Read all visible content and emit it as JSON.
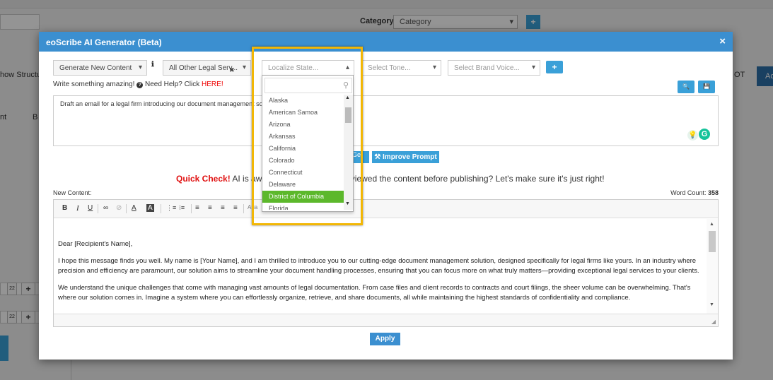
{
  "background": {
    "category_label": "Category",
    "category_select_value": "Category",
    "left_text_1": "how Structu",
    "left_text_2": "nt",
    "left_text_3": "B",
    "right_text_1": "OT",
    "right_text_2": "Ac",
    "row_ctl_1": "22",
    "row_ctl_2": "+"
  },
  "modal": {
    "title": "eoScribe AI Generator (Beta)",
    "close_glyph": "×"
  },
  "controls": {
    "content_type": "Generate New Content",
    "legal_service": "All Other Legal Serv...",
    "state_placeholder": "Localize State...",
    "tone_placeholder": "Select Tone...",
    "brand_voice_placeholder": "Select Brand Voice...",
    "caret": "▾",
    "caret_up": "▴",
    "x_glyph": "✖",
    "info_glyph": "ℹ",
    "plus_glyph": "+"
  },
  "help": {
    "text": "Write something amazing!",
    "need_help": "Need Help? Click",
    "here": "HERE!",
    "q_glyph": "?"
  },
  "icons": {
    "search_glyph": "🔍",
    "save_glyph": "💾",
    "bulb_glyph": "💡",
    "grammarly_glyph": "G",
    "magnifier_glyph": "⚲",
    "resize_glyph": "◢",
    "scroll_up": "▲",
    "scroll_down": "▼"
  },
  "prompt": {
    "text": "Draft an email for a legal firm introducing our document management solution"
  },
  "buttons": {
    "generate_visible": "Ge",
    "improve_prompt": "Improve Prompt",
    "improve_glyph": "⚒",
    "apply": "Apply"
  },
  "quick_check": {
    "label": "Quick Check!",
    "text": "AI is awesome, but have you reviewed the content before publishing? Let's make sure it's just right!"
  },
  "editor": {
    "label": "New Content:",
    "word_count_label": "Word Count:",
    "word_count": "358",
    "toolbar": {
      "bold": "B",
      "italic": "I",
      "underline": "U",
      "link": "∞",
      "unlink": "⊘",
      "font_color": "A",
      "bg_color": "A",
      "ordered_list": "⋮≡",
      "bullet_list": "⁝≡",
      "align_left": "≡",
      "align_center": "≡",
      "align_right": "≡",
      "justify": "≡",
      "font": "Aria"
    },
    "paragraphs": [
      "Dear [Recipient's Name],",
      "I hope this message finds you well. My name is [Your Name], and I am thrilled to introduce you to our cutting-edge document management solution, designed specifically for legal firms like yours. In an industry where precision and efficiency are paramount, our solution aims to streamline your document handling processes, ensuring that you can focus more on what truly matters—providing exceptional legal services to your clients.",
      "We understand the unique challenges that come with managing vast amounts of legal documentation. From case files and client records to contracts and court filings, the sheer volume can be overwhelming. That's where our solution comes in. Imagine a system where you can effortlessly organize, retrieve, and share documents, all while maintaining the highest standards of confidentiality and compliance."
    ]
  },
  "state_dropdown": {
    "search_value": "",
    "options": [
      "Alaska",
      "American Samoa",
      "Arizona",
      "Arkansas",
      "California",
      "Colorado",
      "Connecticut",
      "Delaware",
      "District of Columbia",
      "Florida"
    ],
    "highlighted": "District of Columbia"
  },
  "colors": {
    "header_blue": "#3b8fd0",
    "button_blue": "#3aa0d8",
    "highlight_green": "#5cb82b",
    "callout_yellow": "#f2b705",
    "quick_check_red": "#e01010"
  }
}
